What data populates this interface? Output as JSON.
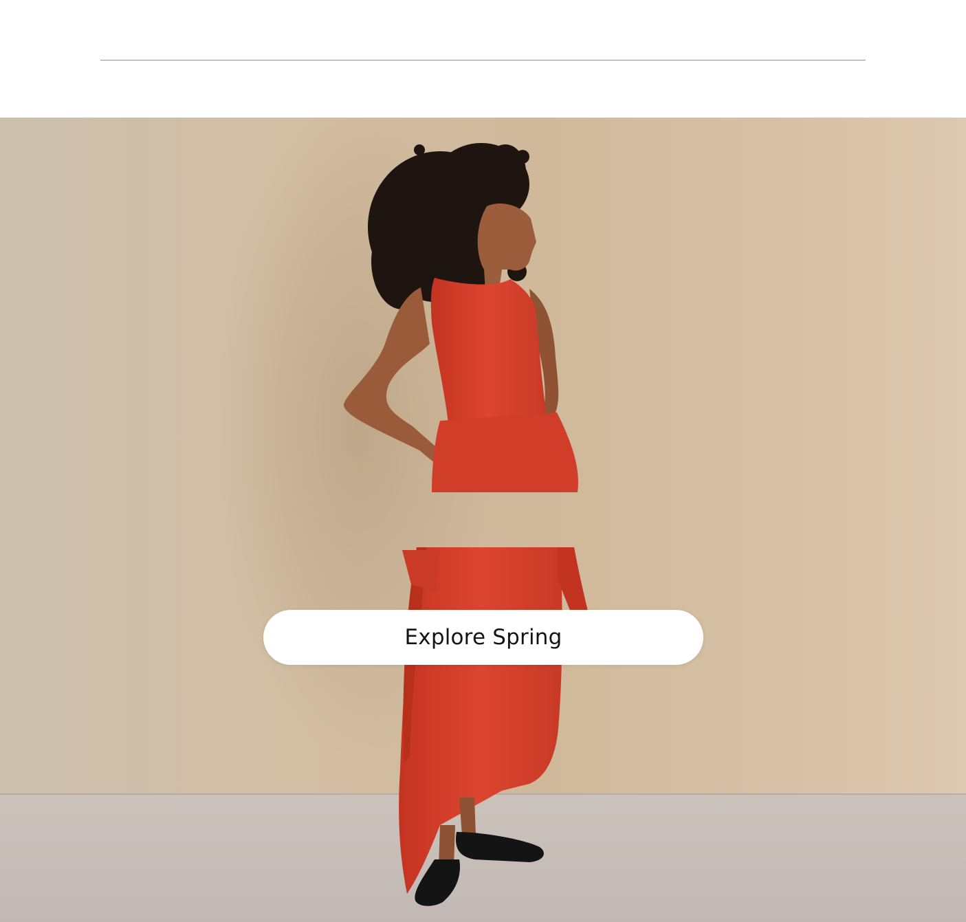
{
  "hero": {
    "cta_label": "Explore Spring",
    "image_subject": "model-in-red-dress"
  },
  "colors": {
    "page_background": "#ffffff",
    "divider": "#8f8f8f",
    "wall": "#cdb79e",
    "floor": "#c8bfb8",
    "dress": "#d8402c",
    "hair": "#1e1510",
    "skin": "#9c5d3c",
    "shoes": "#141414",
    "cta_background": "#ffffff",
    "cta_text": "#141414"
  }
}
